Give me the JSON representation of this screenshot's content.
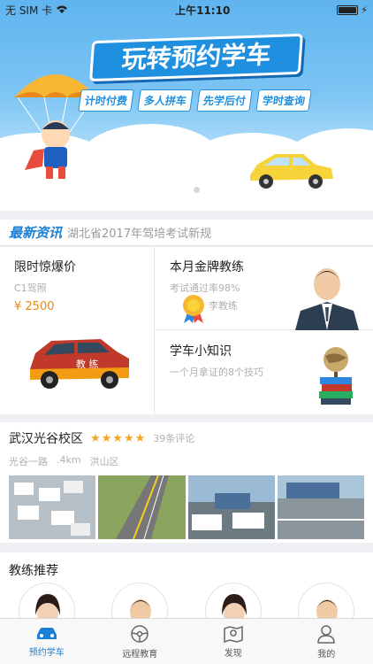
{
  "status": {
    "carrier": "无 SIM 卡",
    "time": "上午11:10"
  },
  "banner": {
    "title": "玩转预约学车",
    "tags": [
      "计时付费",
      "多人拼车",
      "先学后付",
      "学时查询"
    ]
  },
  "news": {
    "tag": "最新资讯",
    "text": "湖北省2017年驾培考试新规"
  },
  "promo": {
    "left": {
      "title": "限时惊爆价",
      "subtitle": "C1驾照",
      "price": "¥ 2500",
      "car_text": "教 练"
    },
    "top_right": {
      "title": "本月金牌教练",
      "subtitle": "考试通过率98%",
      "coach": "李教练"
    },
    "bottom_right": {
      "title": "学车小知识",
      "subtitle": "一个月拿证的8个技巧"
    }
  },
  "school": {
    "name": "武汉光谷校区",
    "stars": "★★★★★",
    "reviews": "39条评论",
    "address": "光谷一路",
    "distance": ".4km",
    "district": "洪山区"
  },
  "coach": {
    "title": "教练推荐"
  },
  "tabbar": {
    "items": [
      {
        "label": "预约学车",
        "icon": "car-icon",
        "active": true
      },
      {
        "label": "远程教育",
        "icon": "steering-wheel-icon",
        "active": false
      },
      {
        "label": "发现",
        "icon": "map-icon",
        "active": false
      },
      {
        "label": "我的",
        "icon": "person-icon",
        "active": false
      }
    ]
  },
  "colors": {
    "accent": "#1a7fd6",
    "price": "#e8891a",
    "star": "#f5a623"
  }
}
